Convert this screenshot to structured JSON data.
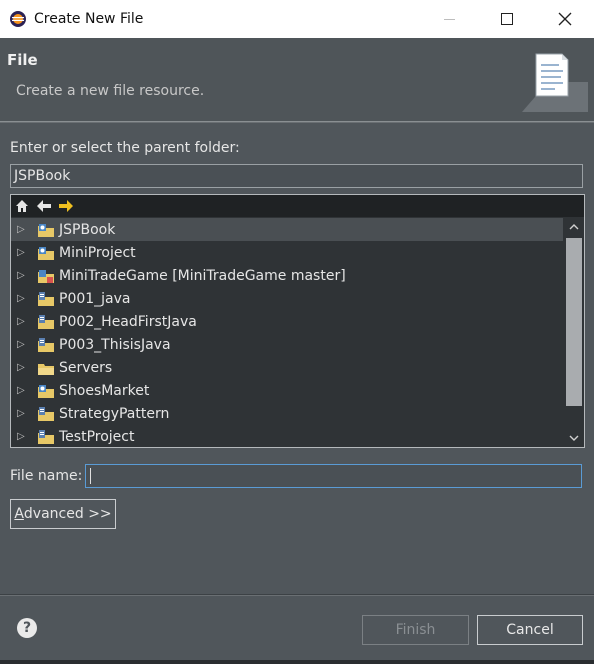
{
  "window": {
    "title": "Create New File"
  },
  "header": {
    "title": "File",
    "description": "Create a new file resource.",
    "image_icon": "new-file-wizard-icon"
  },
  "parent_folder": {
    "label": "Enter or select the parent folder:",
    "value": "JSPBook"
  },
  "tree": {
    "toolbar": {
      "home_icon": "home-icon",
      "back_icon": "back-arrow-icon",
      "forward_icon": "forward-arrow-icon"
    },
    "items": [
      {
        "label": "JSPBook",
        "icon": "web-project-folder-icon",
        "selected": true
      },
      {
        "label": "MiniProject",
        "icon": "web-project-folder-icon",
        "selected": false
      },
      {
        "label": "MiniTradeGame [MiniTradeGame master]",
        "icon": "git-project-folder-icon",
        "selected": false
      },
      {
        "label": "P001_java",
        "icon": "java-project-folder-icon",
        "selected": false
      },
      {
        "label": "P002_HeadFirstJava",
        "icon": "java-project-folder-icon",
        "selected": false
      },
      {
        "label": "P003_ThisisJava",
        "icon": "java-project-folder-icon",
        "selected": false
      },
      {
        "label": "Servers",
        "icon": "folder-icon",
        "selected": false
      },
      {
        "label": "ShoesMarket",
        "icon": "web-project-folder-icon",
        "selected": false
      },
      {
        "label": "StrategyPattern",
        "icon": "java-project-folder-icon",
        "selected": false
      },
      {
        "label": "TestProject",
        "icon": "java-project-folder-icon",
        "selected": false
      }
    ]
  },
  "file_name": {
    "label": "File name:",
    "value": ""
  },
  "buttons": {
    "advanced_mnemonic": "A",
    "advanced_rest": "dvanced >>",
    "finish": "Finish",
    "cancel": "Cancel",
    "help_icon": "help-icon"
  },
  "colors": {
    "accent_focus": "#5a9bd5",
    "selection_arrow": "#f0c020",
    "dialog_bg": "#50565b",
    "tree_bg": "#2f3336"
  }
}
